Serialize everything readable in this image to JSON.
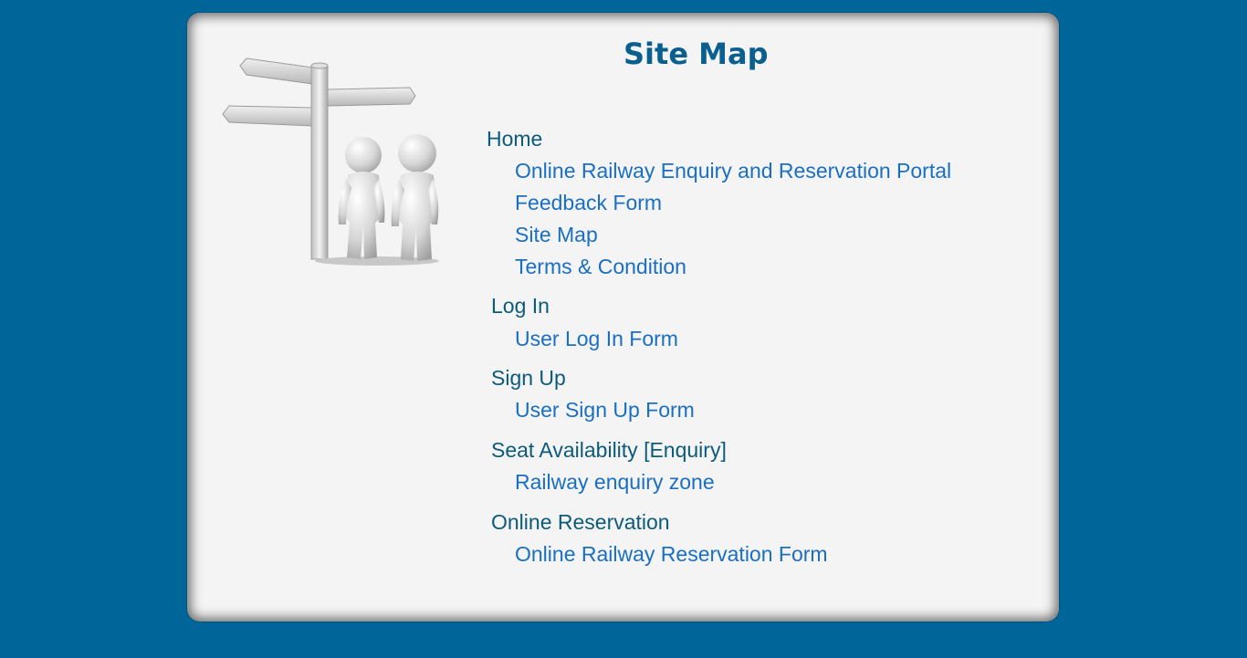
{
  "page_title": "Site Map",
  "sections": {
    "home": {
      "label": "Home",
      "links": [
        "Online Railway Enquiry and Reservation Portal",
        "Feedback Form",
        "Site Map",
        "Terms & Condition"
      ]
    },
    "login": {
      "label": "Log In",
      "links": [
        "User Log In Form"
      ]
    },
    "signup": {
      "label": "Sign Up",
      "links": [
        "User Sign Up Form"
      ]
    },
    "seat": {
      "label": "Seat Availability [Enquiry]",
      "links": [
        "Railway enquiry zone"
      ]
    },
    "reservation": {
      "label": "Online Reservation",
      "links": [
        "Online Railway Reservation Form"
      ]
    }
  },
  "colors": {
    "background": "#006699",
    "panel": "#f4f4f4",
    "title": "#0b5f8f",
    "section": "#0d5b7a",
    "link": "#1a6fc2"
  },
  "illustration": "signpost-with-two-figures"
}
